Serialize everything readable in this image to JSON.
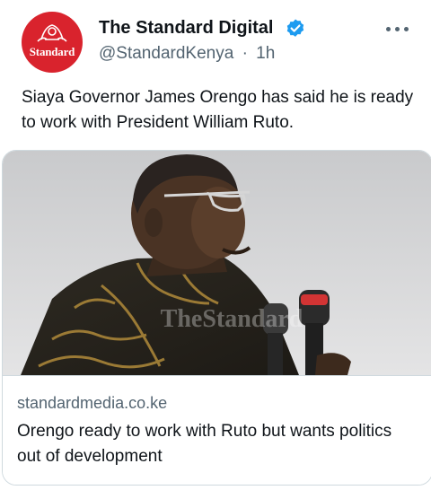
{
  "author": {
    "display_name": "The Standard Digital",
    "handle": "@StandardKenya",
    "separator": "·",
    "time": "1h",
    "avatar_text": "Standard",
    "verified": true
  },
  "tweet": {
    "text": "Siaya Governor James Orengo has said he is ready to work with President William Ruto."
  },
  "card": {
    "domain": "standardmedia.co.ke",
    "title": "Orengo ready to work with Ruto but wants politics out of development",
    "image_watermark": "TheStandard"
  },
  "icons": {
    "verified": "verified-badge-icon",
    "more": "more-options-icon"
  },
  "colors": {
    "brand_red": "#d9232d",
    "verified_blue": "#1d9bf0",
    "secondary_text": "#536471",
    "primary_text": "#0f1419",
    "border": "#cfd9de"
  }
}
